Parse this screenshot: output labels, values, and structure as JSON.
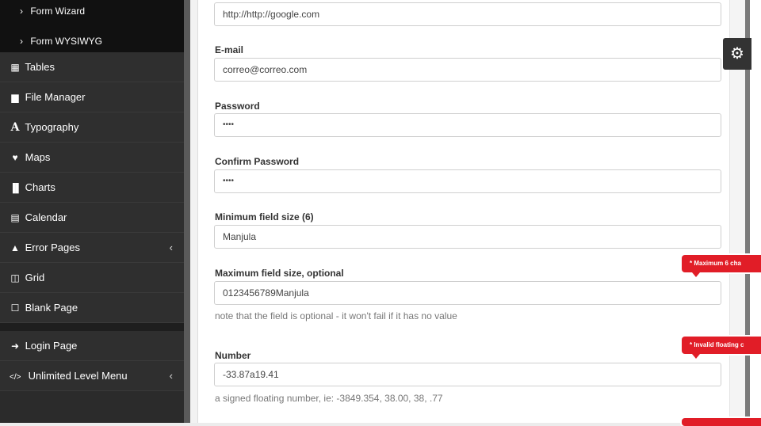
{
  "sidebar": {
    "sub_items": [
      {
        "label": "Form Wizard"
      },
      {
        "label": "Form WYSIWYG"
      }
    ],
    "items": [
      {
        "label": "Tables",
        "icon": "table-icon"
      },
      {
        "label": "File Manager",
        "icon": "file-icon"
      },
      {
        "label": "Typography",
        "icon": "font-icon"
      },
      {
        "label": "Maps",
        "icon": "map-marker-icon"
      },
      {
        "label": "Charts",
        "icon": "bar-chart-icon"
      },
      {
        "label": "Calendar",
        "icon": "calendar-icon"
      },
      {
        "label": "Error Pages",
        "icon": "warning-icon",
        "caret": "‹"
      },
      {
        "label": "Grid",
        "icon": "columns-icon"
      },
      {
        "label": "Blank Page",
        "icon": "square-icon"
      }
    ],
    "bottom_items": [
      {
        "label": "Login Page",
        "icon": "sign-in-icon"
      },
      {
        "label": "Unlimited Level Menu",
        "icon": "code-icon",
        "caret": "‹"
      }
    ]
  },
  "form": {
    "url": {
      "value": "http://http://google.com"
    },
    "email": {
      "label": "E-mail",
      "value": "correo@correo.com"
    },
    "password": {
      "label": "Password",
      "value": "••••"
    },
    "confirm_password": {
      "label": "Confirm Password",
      "value": "••••"
    },
    "min_size": {
      "label": "Minimum field size (6)",
      "value": "Manjula"
    },
    "max_size": {
      "label": "Maximum field size, optional",
      "value": "0123456789Manjula",
      "help": "note that the field is optional - it won't fail if it has no value",
      "error": "* Maximum 6 cha"
    },
    "number": {
      "label": "Number",
      "value": "-33.87a19.41",
      "help": "a signed floating number, ie: -3849.354, 38.00, 38, .77",
      "error": "* Invalid floating c"
    }
  },
  "colors": {
    "sidebar_bg": "#2f2f2f",
    "submenu_bg": "#111111",
    "error_red": "#e11d27"
  }
}
